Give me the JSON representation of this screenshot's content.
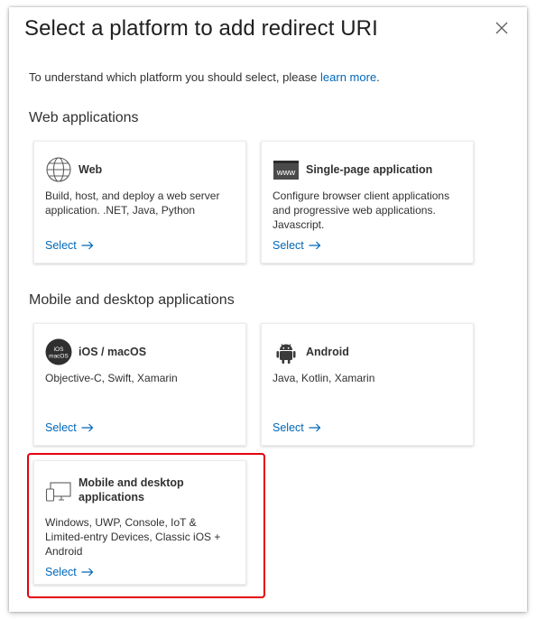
{
  "dialog": {
    "title": "Select a platform to add redirect URI",
    "intro_text": "To understand which platform you should select, please ",
    "intro_link": "learn more",
    "intro_end": "."
  },
  "sections": {
    "web": {
      "title": "Web applications"
    },
    "mobile": {
      "title": "Mobile and desktop applications"
    }
  },
  "cards": {
    "web": {
      "icon": "globe-icon",
      "title": "Web",
      "description": "Build, host, and deploy a web server application. .NET, Java, Python",
      "select": "Select"
    },
    "spa": {
      "icon": "www-icon",
      "icon_text": "www",
      "title": "Single-page application",
      "description": "Configure browser client applications and progressive web applications. Javascript.",
      "select": "Select"
    },
    "ios": {
      "icon": "ios-macos-icon",
      "icon_text_1": "iOS",
      "icon_text_2": "macOS",
      "title": "iOS / macOS",
      "description": "Objective-C, Swift, Xamarin",
      "select": "Select"
    },
    "android": {
      "icon": "android-icon",
      "title": "Android",
      "description": "Java, Kotlin, Xamarin",
      "select": "Select"
    },
    "desktop": {
      "icon": "desktop-icon",
      "title": "Mobile and desktop applications",
      "description": "Windows, UWP, Console, IoT & Limited-entry Devices, Classic iOS + Android",
      "select": "Select"
    }
  },
  "colors": {
    "link": "#0067b8",
    "highlight": "#e3000f",
    "text": "#323130"
  }
}
